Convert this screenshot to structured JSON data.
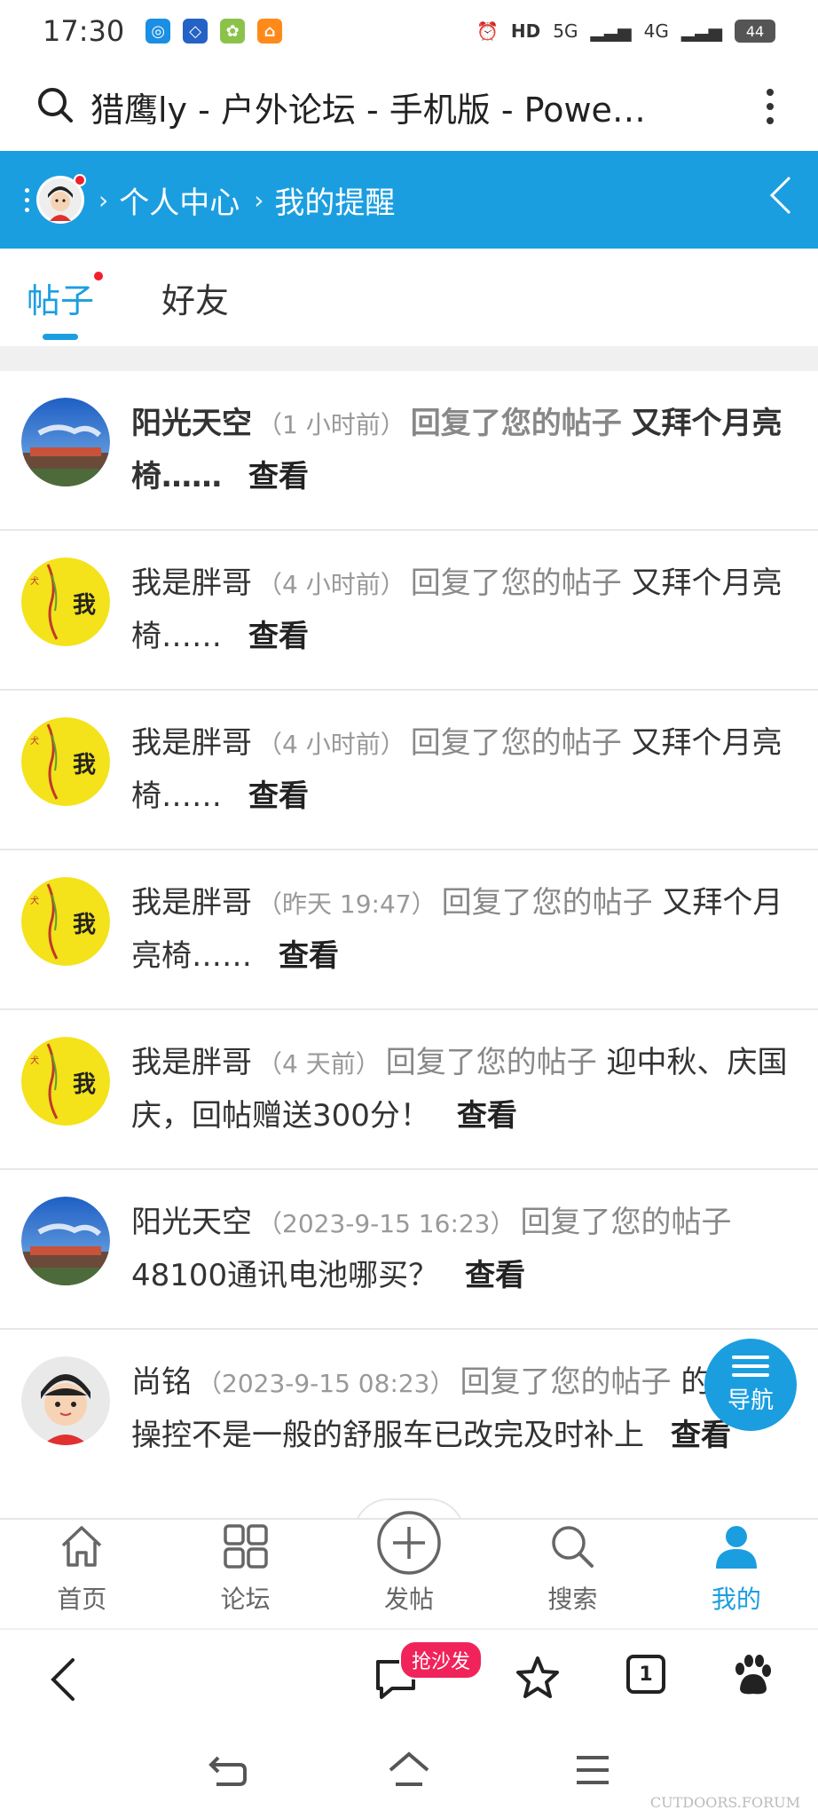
{
  "status_bar": {
    "time": "17:30",
    "network_hd": "HD",
    "network_5g": "5G",
    "network_4g": "4G",
    "battery": "44"
  },
  "browser": {
    "title": "猎鹰ly - 户外论坛 - 手机版 - Powe…"
  },
  "header": {
    "crumb_1": "个人中心",
    "crumb_2": "我的提醒"
  },
  "tabs": {
    "posts": "帖子",
    "friends": "好友"
  },
  "notifications": [
    {
      "user": "阳光天空",
      "time": "（1 小时前）",
      "verb": "回复了您的帖子",
      "subject": "又拜个月亮椅……",
      "action": "查看",
      "unread": true
    },
    {
      "user": "我是胖哥",
      "time": "（4 小时前）",
      "verb": "回复了您的帖子",
      "subject": "又拜个月亮椅……",
      "action": "查看",
      "unread": false
    },
    {
      "user": "我是胖哥",
      "time": "（4 小时前）",
      "verb": "回复了您的帖子",
      "subject": "又拜个月亮椅……",
      "action": "查看",
      "unread": false
    },
    {
      "user": "我是胖哥",
      "time": "（昨天 19:47）",
      "verb": "回复了您的帖子",
      "subject": "又拜个月亮椅……",
      "action": "查看",
      "unread": false
    },
    {
      "user": "我是胖哥",
      "time": "（4 天前）",
      "verb": "回复了您的帖子",
      "subject": "迎中秋、庆国庆，回帖赠送300分！",
      "action": "查看",
      "unread": false
    },
    {
      "user": "阳光天空",
      "time": "（2023-9-15 16:23）",
      "verb": "回复了您的帖子",
      "subject": "48100通讯电池哪买？",
      "action": "查看",
      "unread": false
    },
    {
      "user": "尚铭",
      "time": "（2023-9-15 08:23）",
      "verb": "回复了您的帖子",
      "subject": "的福顺操控不是一般的舒服车已改完及时补上",
      "action": "查看",
      "unread": false
    }
  ],
  "nav_fab": {
    "label": "导航"
  },
  "site_tabbar": {
    "home": "首页",
    "forum": "论坛",
    "post": "发帖",
    "search": "搜索",
    "mine": "我的"
  },
  "browser_toolbar": {
    "sofa_badge": "抢沙发",
    "tab_count": "1"
  },
  "watermark": "CUTDOORS.FORUM",
  "colors": {
    "accent": "#1b9ee0",
    "badge_red": "#f0245a"
  }
}
